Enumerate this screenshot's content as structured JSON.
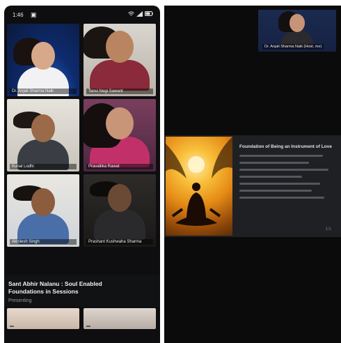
{
  "status_bar": {
    "time": "1:46",
    "notif": "▣"
  },
  "participants": [
    {
      "label": "Dr. Anjali Sharma Naik"
    },
    {
      "label": "Tanvi Negi Sawant"
    },
    {
      "label": "Kunal Lodhi"
    },
    {
      "label": "Pravallika Rawat"
    },
    {
      "label": "Akhilesh Singh"
    },
    {
      "label": "Prashant Kushwaha Sharma"
    }
  ],
  "meeting_strip": {
    "title": "Sant Abhir Nalanu : Soul Enabled Foundations in Sessions",
    "subtitle": "Presenting"
  },
  "bottom_participants": [
    {
      "label": ""
    },
    {
      "label": ""
    }
  ],
  "host": {
    "label": "Dr. Anjali Sharma Naik (Host, me)"
  },
  "slide": {
    "title": "Foundation of Being an Instrument of Love",
    "footer": "1/1"
  },
  "colors": {
    "panel_bg": "#0e0e10",
    "screen_bg": "#0b0b0c",
    "slide_bg": "#1f2023"
  }
}
